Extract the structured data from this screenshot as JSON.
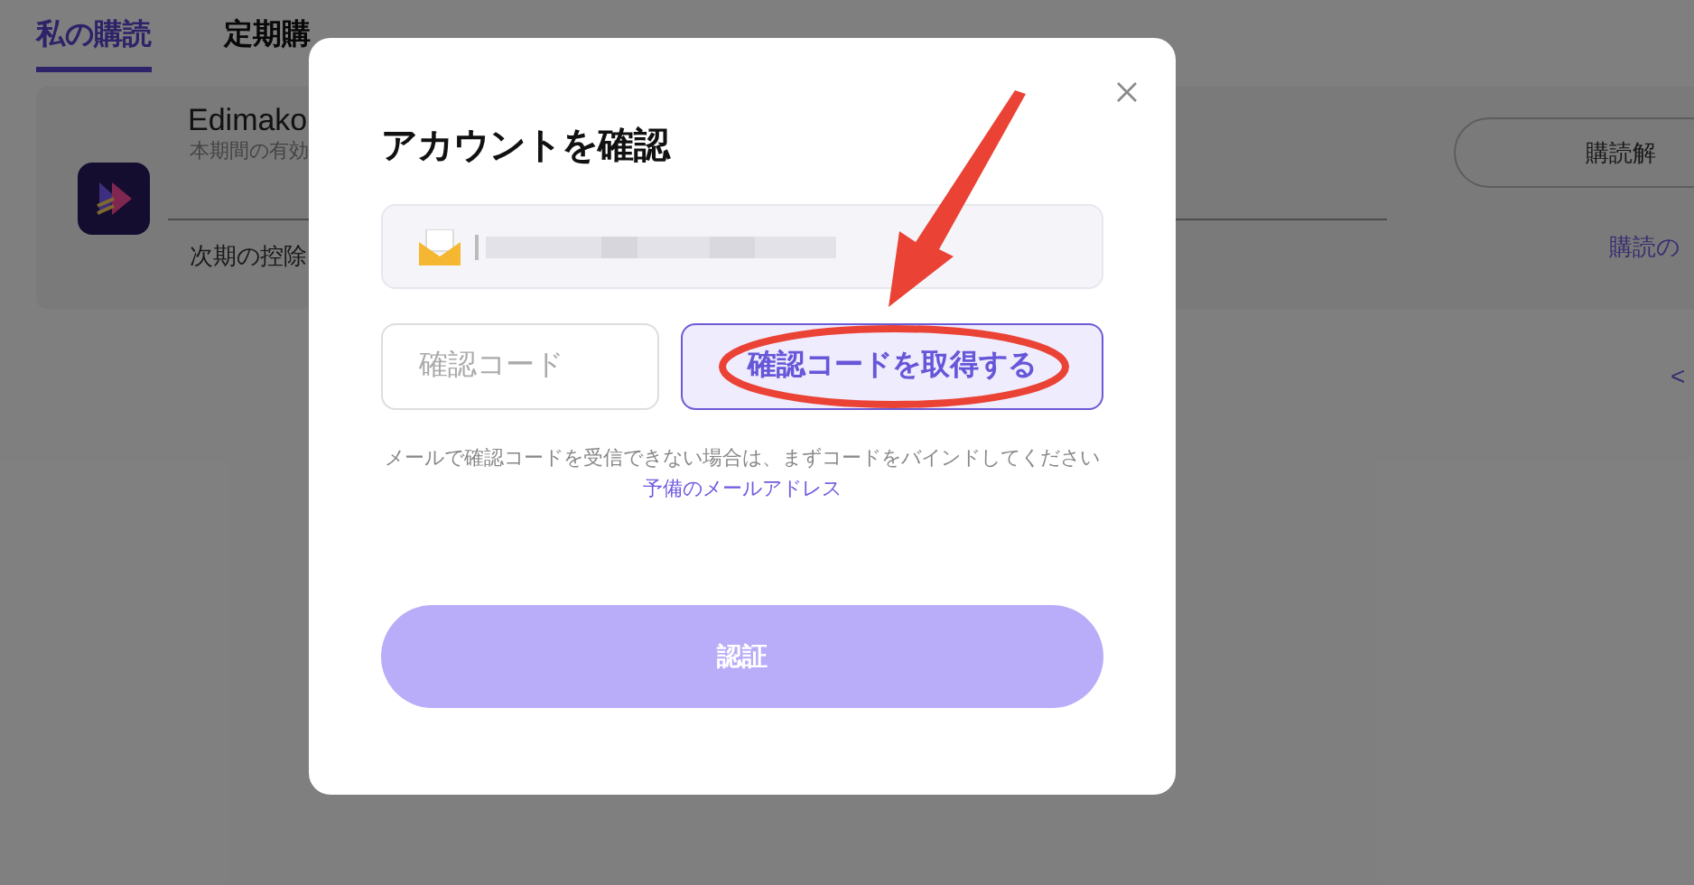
{
  "tabs": [
    {
      "label": "私の購読",
      "selected": true
    },
    {
      "label": "定期購",
      "selected": false
    }
  ],
  "subscription": {
    "product": "Edimako",
    "period_note": "本期間の有効",
    "next_deduction": "次期の控除",
    "cancel_button": "購読解",
    "manage_link": "購読の",
    "pager_prev": "<"
  },
  "dialog": {
    "title": "アカウントを確認",
    "code_field": {
      "placeholder": "確認コード"
    },
    "get_code_button": "確認コードを取得する",
    "help_text": "メールで確認コードを受信できない場合は、まずコードをバインドしてください",
    "help_link": "予備のメールアドレス",
    "verify_button": {
      "label": "認証",
      "disabled": true
    }
  }
}
